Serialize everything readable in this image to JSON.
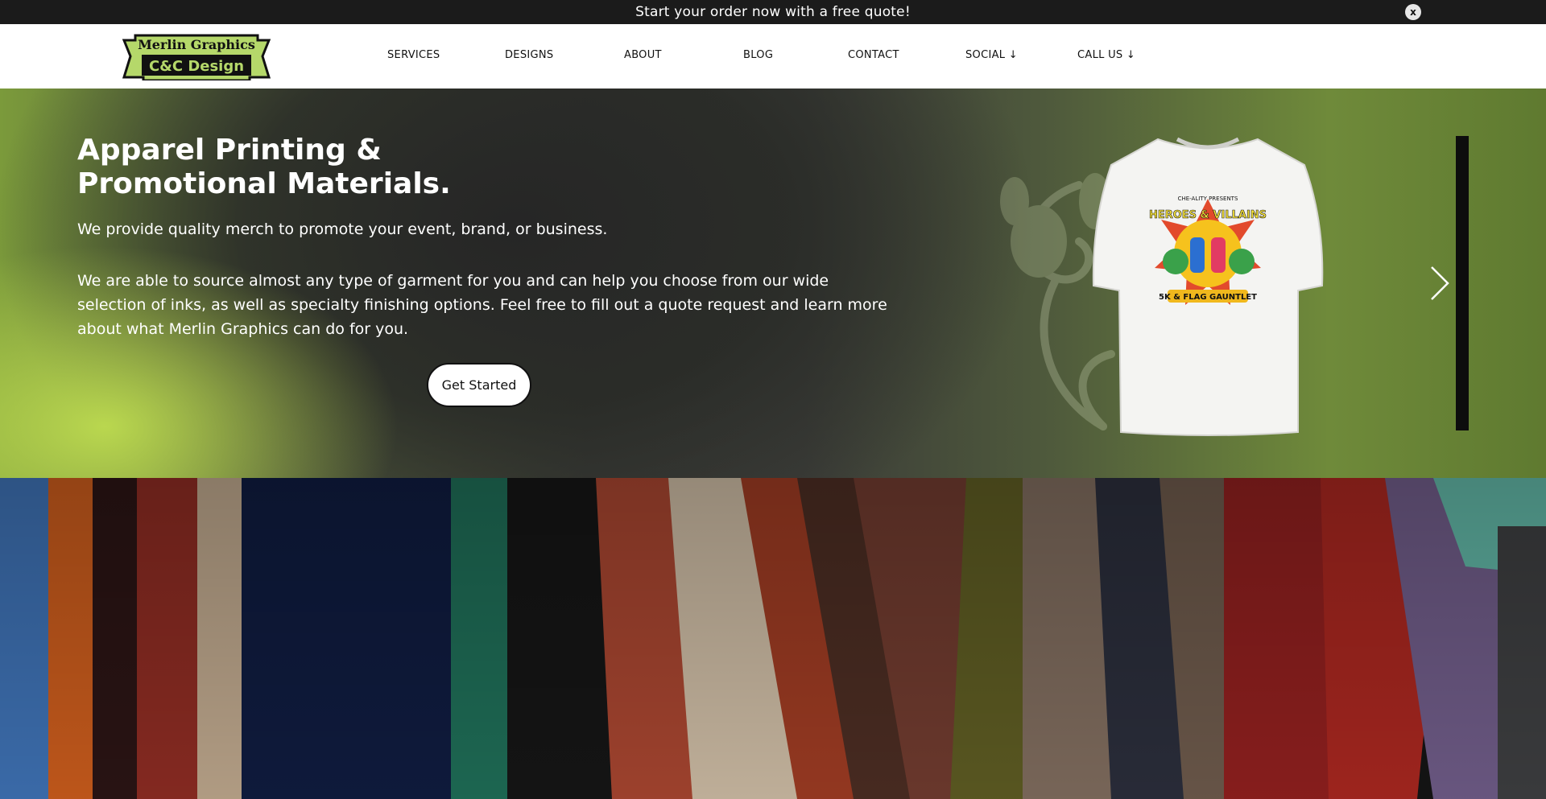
{
  "announcement": {
    "text": "Start your order now with a free quote!",
    "close_label": "x"
  },
  "logo": {
    "line1": "Merlin Graphics",
    "line2": "C&C Design"
  },
  "nav": {
    "items": [
      {
        "label": "SERVICES"
      },
      {
        "label": "DESIGNS"
      },
      {
        "label": "ABOUT"
      },
      {
        "label": "BLOG"
      },
      {
        "label": "CONTACT"
      },
      {
        "label": "SOCIAL ↓"
      },
      {
        "label": "CALL US ↓"
      }
    ]
  },
  "hero": {
    "title_line1": "Apparel Printing &",
    "title_line2": "Promotional Materials.",
    "subtitle": "We provide quality merch to promote your event, brand, or business.",
    "body": "We are able to source almost any type of garment for you and can help you choose from our wide selection of inks, as well as specialty finishing options. Feel free to fill out a quote request and learn more about what Merlin Graphics can do for you.",
    "cta_label": "Get Started",
    "slide_graphic_text": {
      "top": "CHE-ALITY PRESENTS",
      "main": "HEROES & VILLAINS",
      "bottom": "5K & FLAG GAUNTLET"
    }
  },
  "colors": {
    "logo_green": "#b5d86a",
    "hero_green": "#8fb33e",
    "hero_dark": "#3a3b37",
    "topbar_bg": "#1b1b1b"
  },
  "icons": {
    "close": "close-icon",
    "next": "chevron-right-icon"
  }
}
